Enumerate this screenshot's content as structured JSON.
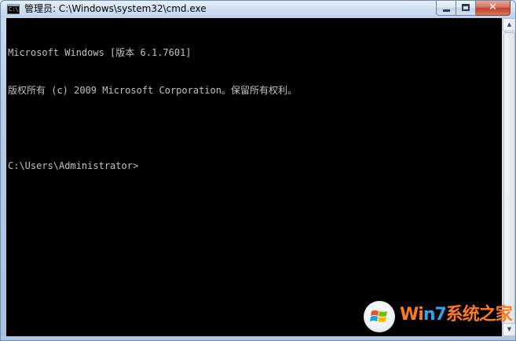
{
  "window": {
    "title": "管理员: C:\\Windows\\system32\\cmd.exe",
    "icon": "cmd-icon",
    "icon_glyph": "C:\\"
  },
  "caption_buttons": {
    "close_glyph": "✕"
  },
  "console": {
    "lines": [
      "Microsoft Windows [版本 6.1.7601]",
      "版权所有 (c) 2009 Microsoft Corporation。保留所有权利。",
      "",
      "C:\\Users\\Administrator>"
    ]
  },
  "scrollbar": {
    "up_glyph": "▲",
    "down_glyph": "▼"
  },
  "watermark": {
    "part1": "Wi",
    "part2": "n7",
    "part3": "系统之家"
  },
  "colors": {
    "console_bg": "#000000",
    "console_fg": "#c0c0c0",
    "watermark_orange": "#ff7a1a",
    "watermark_blue": "#3aa0e8"
  }
}
